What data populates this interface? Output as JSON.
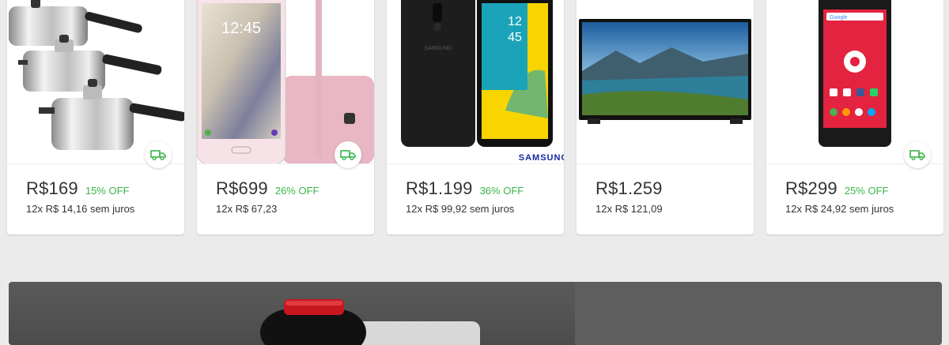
{
  "products": [
    {
      "name": "Panelas de pressão",
      "price": "R$169",
      "discount": "15% OFF",
      "installments": "12x R$ 14,16 sem juros",
      "free_shipping": true
    },
    {
      "name": "Smartphone rosa",
      "price": "R$699",
      "discount": "26% OFF",
      "installments": "12x R$ 67,23",
      "free_shipping": true
    },
    {
      "name": "Smartphone Samsung",
      "price": "R$1.199",
      "discount": "36% OFF",
      "installments": "12x R$ 99,92 sem juros",
      "free_shipping": false,
      "brand_text": "SAMSUNG"
    },
    {
      "name": "Smart TV",
      "price": "R$1.259",
      "discount": "",
      "installments": "12x R$ 121,09",
      "free_shipping": false
    },
    {
      "name": "Smartphone vermelho",
      "price": "R$299",
      "discount": "25% OFF",
      "installments": "12x R$ 24,92 sem juros",
      "free_shipping": true
    }
  ],
  "phone_lockscreen": {
    "time": "12:45"
  },
  "phone_samsung_screen": {
    "hour": "12",
    "minute": "45"
  },
  "phone_red_screen": {
    "search_label": "Google"
  },
  "colors": {
    "discount": "#39b54a",
    "shipping_icon": "#39b54a",
    "text": "#333333",
    "background": "#ebebeb"
  }
}
